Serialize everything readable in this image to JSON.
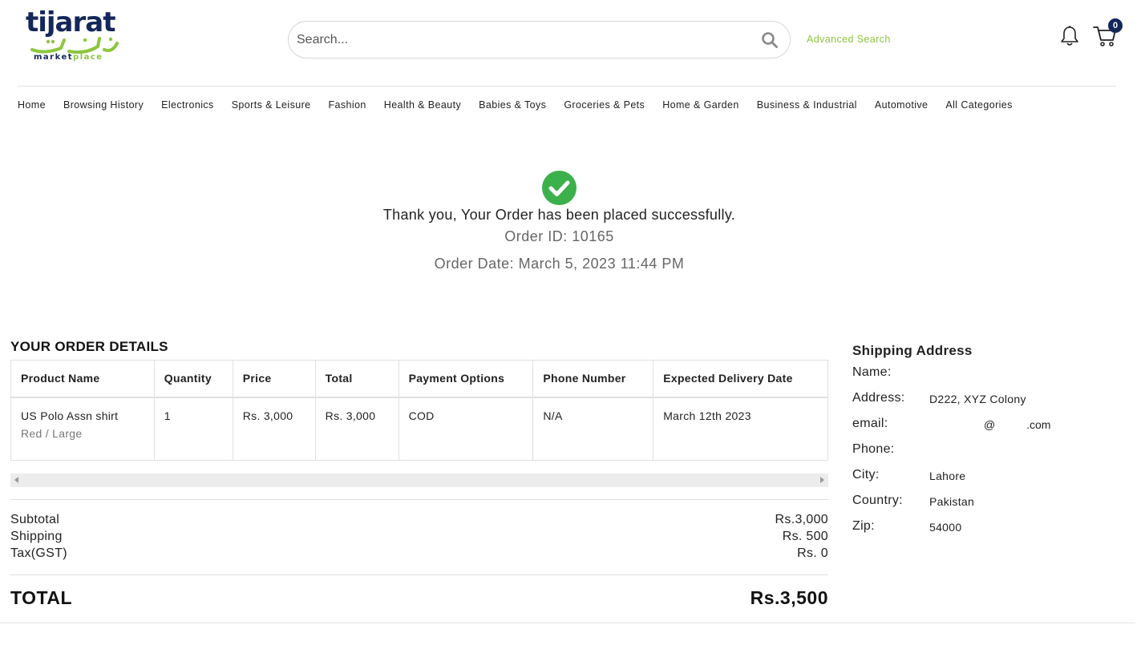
{
  "header": {
    "logo": {
      "brand": "tijarat",
      "sub_dark": "market",
      "sub_green": "place"
    },
    "search": {
      "placeholder": "Search...",
      "value": ""
    },
    "advanced_search_label": "Advanced Search",
    "cart_count": "0"
  },
  "colors": {
    "brand_navy": "#14275a",
    "brand_green": "#8cc63f",
    "success_green": "#3cb04b"
  },
  "nav": [
    "Home",
    "Browsing History",
    "Electronics",
    "Sports & Leisure",
    "Fashion",
    "Health & Beauty",
    "Babies & Toys",
    "Groceries & Pets",
    "Home & Garden",
    "Business & Industrial",
    "Automotive",
    "All Categories"
  ],
  "confirmation": {
    "icon": "check-circle-icon",
    "message": "Thank you, Your Order has been placed successfully.",
    "order_id": "Order ID: 10165",
    "order_date": "Order Date: March 5, 2023 11:44 PM"
  },
  "order_details": {
    "title": "YOUR ORDER DETAILS",
    "columns": [
      "Product Name",
      "Quantity",
      "Price",
      "Total",
      "Payment Options",
      "Phone Number",
      "Expected Delivery Date"
    ],
    "rows": [
      {
        "product": "US Polo Assn shirt",
        "variant": "Red / Large",
        "quantity": "1",
        "price": "Rs. 3,000",
        "total": "Rs. 3,000",
        "payment": "COD",
        "phone": "N/A",
        "delivery": "March 12th 2023"
      }
    ]
  },
  "summary": {
    "subtotal_label": "Subtotal",
    "subtotal_value": "Rs.3,000",
    "shipping_label": "Shipping",
    "shipping_value": "Rs. 500",
    "tax_label": "Tax(GST)",
    "tax_value": "Rs. 0",
    "total_label": "TOTAL",
    "total_value": "Rs.3,500"
  },
  "shipping_address": {
    "title": "Shipping Address",
    "name_label": "Name:",
    "name_value": "",
    "address_label": "Address:",
    "address_value": "D222, XYZ Colony",
    "email_label": "email:",
    "email_value": "@          .com",
    "phone_label": "Phone:",
    "phone_value": "",
    "city_label": "City:",
    "city_value": "Lahore",
    "country_label": "Country:",
    "country_value": "Pakistan",
    "zip_label": "Zip:",
    "zip_value": "54000"
  }
}
